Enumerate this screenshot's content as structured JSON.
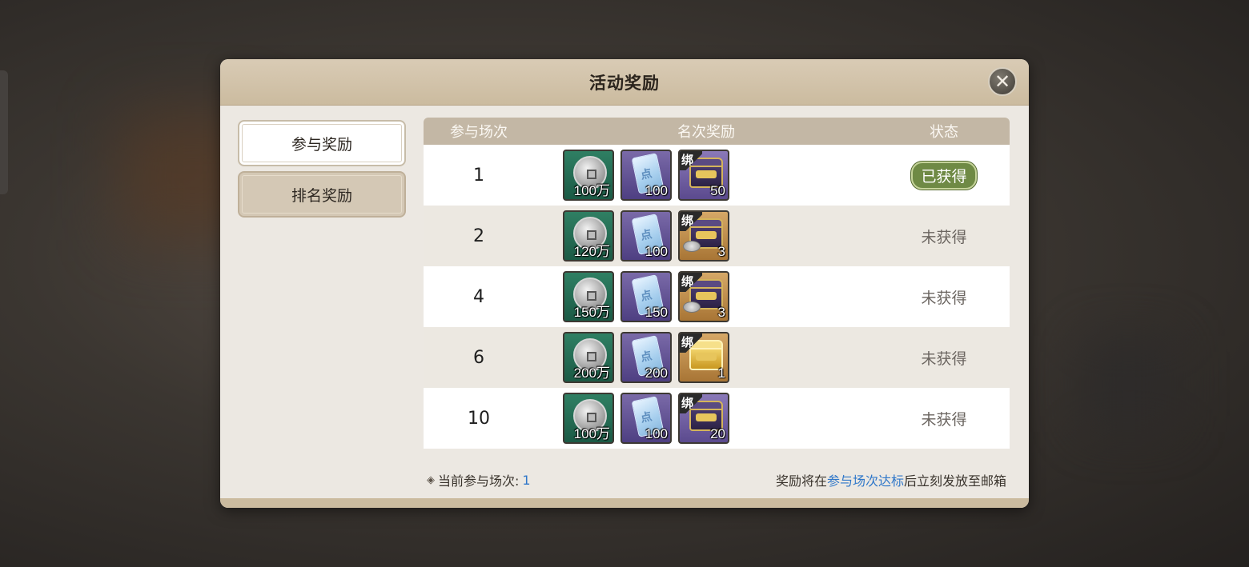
{
  "dialog": {
    "title": "活动奖励",
    "close_icon": "close-icon"
  },
  "tabs": [
    {
      "label": "参与奖励",
      "active": true
    },
    {
      "label": "排名奖励",
      "active": false
    }
  ],
  "table": {
    "headers": {
      "count": "参与场次",
      "reward": "名次奖励",
      "status": "状态"
    },
    "rows": [
      {
        "count": "1",
        "coin_qty": "100万",
        "scroll_qty": "100",
        "chest_qty": "50",
        "status": "已获得"
      },
      {
        "count": "2",
        "coin_qty": "120万",
        "scroll_qty": "100",
        "chest_qty": "3",
        "status": "未获得"
      },
      {
        "count": "4",
        "coin_qty": "150万",
        "scroll_qty": "150",
        "chest_qty": "3",
        "status": "未获得"
      },
      {
        "count": "6",
        "coin_qty": "200万",
        "scroll_qty": "200",
        "chest_qty": "1",
        "status": "未获得"
      },
      {
        "count": "10",
        "coin_qty": "100万",
        "scroll_qty": "100",
        "chest_qty": "20",
        "status": "未获得"
      }
    ]
  },
  "item_labels": {
    "bind": "绑",
    "scroll_char": "点"
  },
  "footer": {
    "current_label": "当前参与场次:",
    "current_value": "1",
    "note_prefix": "奖励将在",
    "note_highlight": "参与场次达标",
    "note_suffix": "后立刻发放至邮箱"
  },
  "colors": {
    "header_bar": "#cbbb9f",
    "table_head": "#c3b7a5",
    "highlight_text": "#2f77c9",
    "status_got_bg": "#6f8a45"
  }
}
